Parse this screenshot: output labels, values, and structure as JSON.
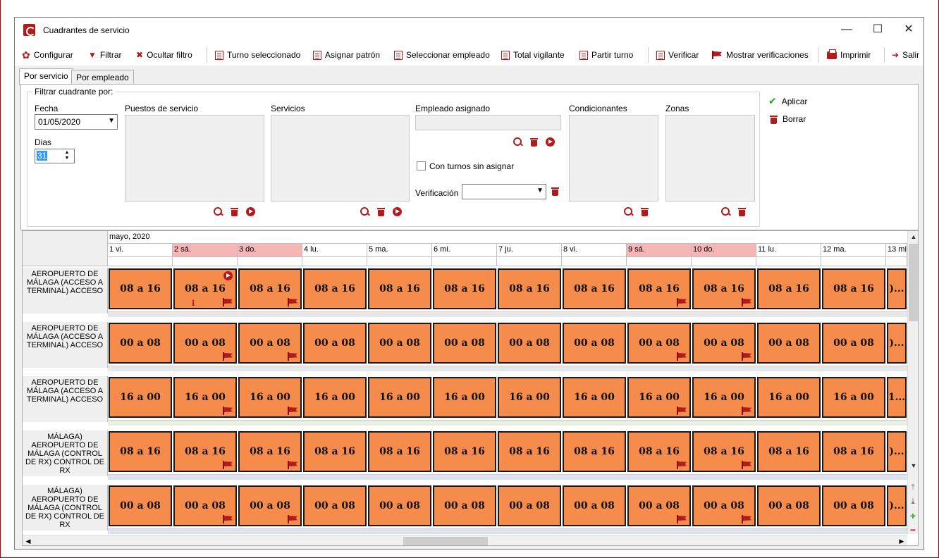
{
  "window": {
    "title": "Cuadrantes de servicio",
    "minimize": "—",
    "maximize": "☐",
    "close": "✕"
  },
  "toolbar": {
    "configurar": "Configurar",
    "filtrar": "Filtrar",
    "ocultar_filtro": "Ocultar filtro",
    "turno_seleccionado": "Turno seleccionado",
    "asignar_patron": "Asignar patrón",
    "seleccionar_empleado": "Seleccionar empleado",
    "total_vigilante": "Total vigilante",
    "partir_turno": "Partir turno",
    "verificar": "Verificar",
    "mostrar_verificaciones": "Mostrar verificaciones",
    "imprimir": "Imprimir",
    "salir": "Salir"
  },
  "tabs": {
    "por_servicio": "Por servicio",
    "por_empleado": "Por empleado"
  },
  "filter": {
    "legend": "Filtrar cuadrante por:",
    "fecha_label": "Fecha",
    "fecha_value": "01/05/2020",
    "dias_label": "Dias",
    "dias_value": "31",
    "puestos_label": "Puestos de servicio",
    "servicios_label": "Servicios",
    "empleado_label": "Empleado asignado",
    "con_turnos": "Con turnos sin asignar",
    "verificacion_label": "Verificación",
    "condicionantes_label": "Condicionantes",
    "zonas_label": "Zonas",
    "aplicar": "Aplicar",
    "borrar": "Borrar"
  },
  "grid": {
    "month": "mayo, 2020",
    "days": [
      {
        "label": "1 vi.",
        "weekend": false
      },
      {
        "label": "2 sá.",
        "weekend": true
      },
      {
        "label": "3 do.",
        "weekend": true
      },
      {
        "label": "4 lu.",
        "weekend": false
      },
      {
        "label": "5 ma.",
        "weekend": false
      },
      {
        "label": "6 mi.",
        "weekend": false
      },
      {
        "label": "7 ju.",
        "weekend": false
      },
      {
        "label": "8 vi.",
        "weekend": false
      },
      {
        "label": "9 sá.",
        "weekend": true
      },
      {
        "label": "10 do.",
        "weekend": true
      },
      {
        "label": "11 lu.",
        "weekend": false
      },
      {
        "label": "12 ma.",
        "weekend": false
      },
      {
        "label": "13 mi",
        "weekend": false
      }
    ],
    "rows": [
      {
        "label": "AEROPUERTO DE MÁLAGA (ACCESO A TERMINAL) ACCESO",
        "shift": "08 a 16",
        "last": ")...",
        "bottom": "gray",
        "flags": [
          1,
          2,
          8,
          9
        ],
        "info_day": 1,
        "go_day": 1
      },
      {
        "label": "AEROPUERTO DE MÁLAGA (ACCESO A TERMINAL) ACCESO",
        "shift": "00 a 08",
        "last": ")...",
        "bottom": "gray",
        "flags": [
          1,
          2,
          8,
          9
        ],
        "info_day": -1,
        "go_day": -1
      },
      {
        "label": "AEROPUERTO DE MÁLAGA (ACCESO A TERMINAL) ACCESO",
        "shift": "16 a 00",
        "last": "1...",
        "bottom": "green",
        "flags": [
          1,
          2,
          8,
          9
        ],
        "info_day": -1,
        "go_day": -1
      },
      {
        "label": "MÁLAGA) AEROPUERTO DE MÁLAGA (CONTROL DE RX) CONTROL DE RX",
        "shift": "08 a 16",
        "last": ")...",
        "bottom": "blue",
        "flags": [
          1,
          2,
          8,
          9
        ],
        "info_day": -1,
        "go_day": -1
      },
      {
        "label": "MÁLAGA) AEROPUERTO DE MÁLAGA (CONTROL DE RX) CONTROL DE RX",
        "shift": "00 a 08",
        "last": ")...",
        "bottom": "blue",
        "flags": [
          1,
          2,
          8,
          9
        ],
        "info_day": -1,
        "go_day": -1
      }
    ]
  },
  "colors": {
    "accent": "#b31b1b",
    "cell": "#f58c4c",
    "weekend_header": "#f6b6b6"
  }
}
